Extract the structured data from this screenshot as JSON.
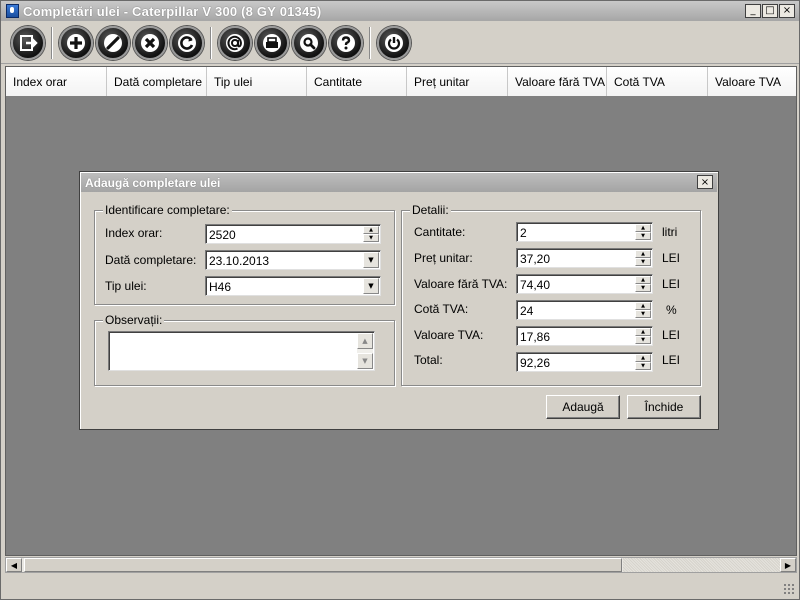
{
  "window": {
    "title": "Completări ulei - Caterpillar  V 300 (8 GY 01345)",
    "controls": [
      "_",
      "□",
      "×"
    ]
  },
  "toolbar": {
    "buttons": [
      {
        "name": "exit-icon"
      },
      {
        "name": "add-icon"
      },
      {
        "name": "edit-icon"
      },
      {
        "name": "delete-icon"
      },
      {
        "name": "refresh-icon"
      },
      {
        "name": "email-icon"
      },
      {
        "name": "print-icon"
      },
      {
        "name": "search-icon"
      },
      {
        "name": "help-icon"
      },
      {
        "name": "power-icon"
      }
    ]
  },
  "grid": {
    "columns": [
      "Index orar",
      "Dată completare",
      "Tip ulei",
      "Cantitate",
      "Preț unitar",
      "Valoare fără TVA",
      "Cotă TVA",
      "Valoare TVA"
    ]
  },
  "dialog": {
    "title": "Adaugă completare ulei",
    "close_symbol": "×",
    "identificare": {
      "legend": "Identificare completare:",
      "index_label": "Index orar:",
      "index_value": "2520",
      "date_label": "Dată completare:",
      "date_value": "23.10.2013",
      "type_label": "Tip ulei:",
      "type_value": "H46"
    },
    "observatii": {
      "legend": "Observații:",
      "value": ""
    },
    "detalii": {
      "legend": "Detalii:",
      "rows": [
        {
          "label": "Cantitate:",
          "value": "2",
          "unit": "litri"
        },
        {
          "label": "Preț unitar:",
          "value": "37,20",
          "unit": "LEI"
        },
        {
          "label": "Valoare fără TVA:",
          "value": "74,40",
          "unit": "LEI"
        },
        {
          "label": "Cotă TVA:",
          "value": "24",
          "unit": "%"
        },
        {
          "label": "Valoare TVA:",
          "value": "17,86",
          "unit": "LEI"
        },
        {
          "label": "Total:",
          "value": "92,26",
          "unit": "LEI"
        }
      ]
    },
    "buttons": {
      "add": "Adaugă",
      "close": "Închide"
    }
  },
  "scrollbar": {
    "left_arrow": "◀",
    "right_arrow": "▶"
  },
  "colors": {
    "face": "#d4d0c8",
    "workspace": "#808080",
    "title_text": "#ffffff"
  }
}
